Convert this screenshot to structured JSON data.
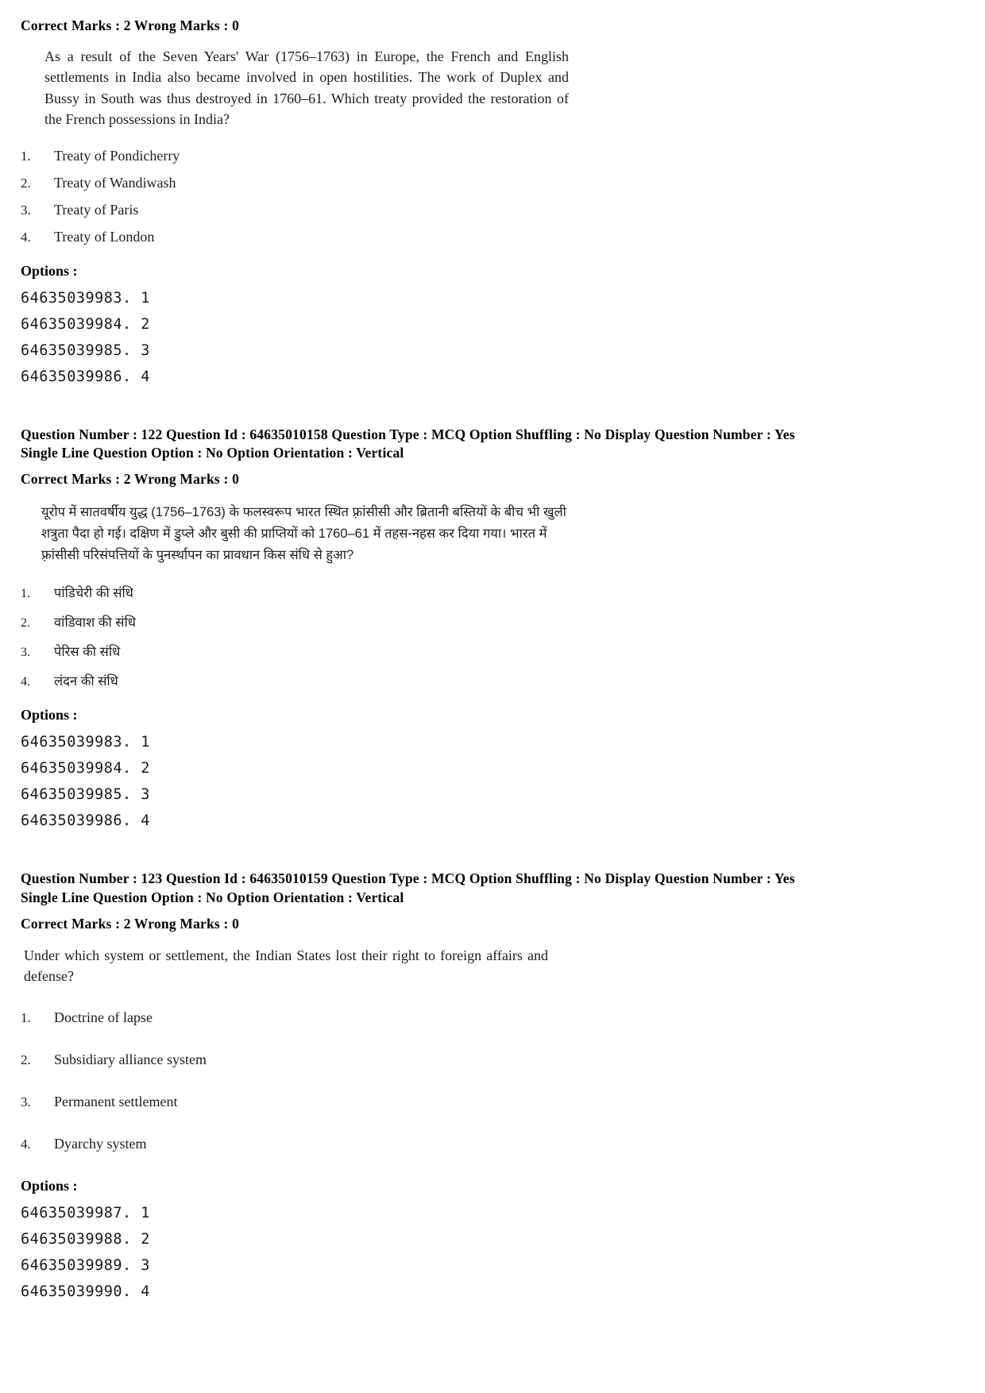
{
  "document": {
    "type": "exam-question-paper",
    "language_pairs": [
      "English",
      "Hindi"
    ]
  },
  "labels": {
    "options_heading": "Options :",
    "correct_marks_prefix": "Correct Marks :",
    "wrong_marks_prefix": "Wrong Marks :"
  },
  "questions": [
    {
      "id": "q121-english-continued",
      "marks_line": "Correct Marks : 2  Wrong Marks : 0",
      "question_text": "As a result of the Seven Years' War (1756–1763) in Europe, the French and English settlements in India also became involved in open hostilities. The work of Duplex and Bussy in South was thus destroyed in 1760–61. Which treaty provided the restoration of the French possessions in India?",
      "choices": [
        {
          "num": "1.",
          "text": "Treaty of Pondicherry"
        },
        {
          "num": "2.",
          "text": "Treaty of Wandiwash"
        },
        {
          "num": "3.",
          "text": "Treaty of Paris"
        },
        {
          "num": "4.",
          "text": "Treaty of London"
        }
      ],
      "options_heading": "Options :",
      "option_ids": [
        "64635039983. 1",
        "64635039984. 2",
        "64635039985. 3",
        "64635039986. 4"
      ]
    },
    {
      "id": "q122-hindi",
      "meta_line_1": "Question Number : 122  Question Id : 64635010158  Question Type : MCQ  Option Shuffling : No  Display Question Number : Yes",
      "meta_line_2": "Single Line Question Option : No  Option Orientation : Vertical",
      "marks_line": "Correct Marks : 2  Wrong Marks : 0",
      "question_text": "यूरोप में सातवर्षीय युद्ध (1756–1763) के फलस्वरूप भारत स्थित फ़्रांसीसी और ब्रितानी बस्तियों के बीच भी खुली शत्रुता पैदा हो गई। दक्षिण में डुप्ले और बुसी की प्राप्तियों को 1760–61 में तहस-नहस कर दिया गया। भारत में फ़्रांसीसी परिसंपत्तियों के पुनर्स्थापन का प्रावधान किस संधि से हुआ?",
      "choices": [
        {
          "num": "1.",
          "text": "पांडिचेरी की संधि"
        },
        {
          "num": "2.",
          "text": "वांडिवाश की संधि"
        },
        {
          "num": "3.",
          "text": "पेरिस की संधि"
        },
        {
          "num": "4.",
          "text": "लंदन की संधि"
        }
      ],
      "options_heading": "Options :",
      "option_ids": [
        "64635039983. 1",
        "64635039984. 2",
        "64635039985. 3",
        "64635039986. 4"
      ]
    },
    {
      "id": "q123-english",
      "meta_line_1": "Question Number : 123  Question Id : 64635010159  Question Type : MCQ  Option Shuffling : No  Display Question Number : Yes",
      "meta_line_2": "Single Line Question Option : No  Option Orientation : Vertical",
      "marks_line": "Correct Marks : 2  Wrong Marks : 0",
      "question_text": "Under which system or settlement, the Indian States lost their right to foreign affairs and defense?",
      "choices": [
        {
          "num": "1.",
          "text": "Doctrine of lapse"
        },
        {
          "num": "2.",
          "text": "Subsidiary alliance system"
        },
        {
          "num": "3.",
          "text": "Permanent settlement"
        },
        {
          "num": "4.",
          "text": "Dyarchy system"
        }
      ],
      "options_heading": "Options :",
      "option_ids": [
        "64635039987. 1",
        "64635039988. 2",
        "64635039989. 3",
        "64635039990. 4"
      ]
    }
  ]
}
